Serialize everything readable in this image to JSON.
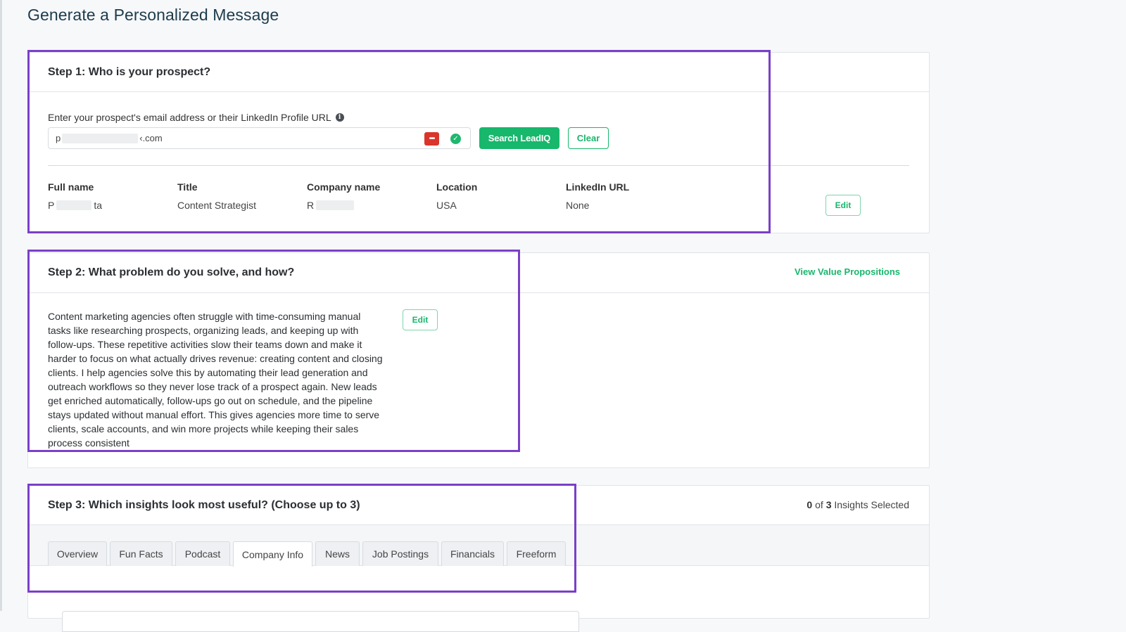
{
  "page": {
    "title": "Generate a Personalized Message"
  },
  "step1": {
    "title": "Step 1: Who is your prospect?",
    "field_label": "Enter your prospect's email address or their LinkedIn Profile URL",
    "email_prefix": "p",
    "email_suffix": "‹.com",
    "search_button": "Search LeadIQ",
    "clear_button": "Clear",
    "edit_button": "Edit",
    "columns": [
      {
        "label": "Full name",
        "value_prefix": "P",
        "value_suffix": "ta"
      },
      {
        "label": "Title",
        "value": "Content Strategist"
      },
      {
        "label": "Company name",
        "value_prefix": "R"
      },
      {
        "label": "Location",
        "value": "USA"
      },
      {
        "label": "LinkedIn URL",
        "value": "None"
      }
    ]
  },
  "step2": {
    "title": "Step 2: What problem do you solve, and how?",
    "view_link": "View Value Propositions",
    "edit_button": "Edit",
    "text": "Content marketing agencies often struggle with time-consuming manual tasks like researching prospects, organizing leads, and keeping up with follow-ups. These repetitive activities slow their teams down and make it harder to focus on what actually drives revenue: creating content and closing clients. I help agencies solve this by automating their lead generation and outreach workflows so they never lose track of a prospect again. New leads get enriched automatically, follow-ups go out on schedule, and the pipeline stays updated without manual effort. This gives agencies more time to serve clients, scale accounts, and win more projects while keeping their sales process consistent"
  },
  "step3": {
    "title": "Step 3: Which insights look most useful? (Choose up to 3)",
    "selected_count": "0",
    "of_label": "of",
    "max_count": "3",
    "selected_label": "Insights Selected",
    "tabs": [
      {
        "label": "Overview"
      },
      {
        "label": "Fun Facts"
      },
      {
        "label": "Podcast"
      },
      {
        "label": "Company Info"
      },
      {
        "label": "News"
      },
      {
        "label": "Job Postings"
      },
      {
        "label": "Financials"
      },
      {
        "label": "Freeform"
      }
    ],
    "active_tab": "Company Info"
  },
  "colors": {
    "accent_green": "#17b76c",
    "highlight_purple": "#7a3fc8",
    "title_navy": "#1c3b4c"
  },
  "icons": {
    "info": "info-icon",
    "password_manager": "password-manager-icon",
    "valid": "check-circle-icon"
  }
}
